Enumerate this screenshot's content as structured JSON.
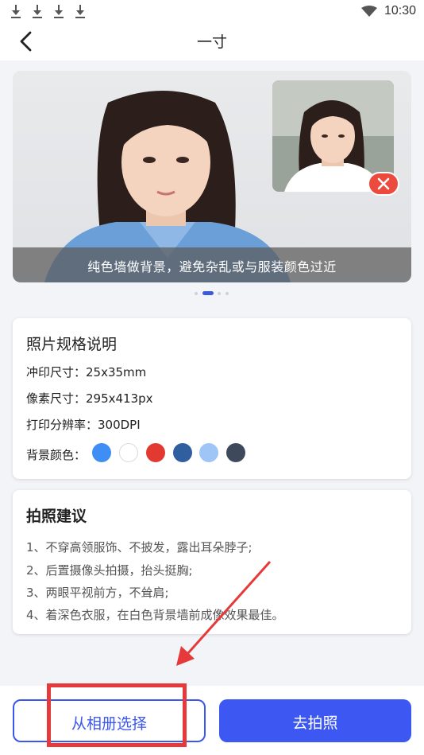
{
  "status_bar": {
    "time": "10:30",
    "download_icons": [
      "download-icon",
      "download-icon",
      "download-icon",
      "download-icon"
    ]
  },
  "nav": {
    "title": "一寸",
    "back_icon": "chevron-left-icon"
  },
  "banner": {
    "caption": "纯色墙做背景，避免杂乱或与服装颜色过近",
    "reject_icon": "close-icon",
    "slide_count": 4,
    "active_slide": 1
  },
  "spec": {
    "title": "照片规格说明",
    "print_size": "冲印尺寸：25x35mm",
    "pixel_size": "像素尺寸：295x413px",
    "resolution": "打印分辨率：300DPI",
    "bg_label": "背景颜色：",
    "bg_colors": [
      "#3f8ef5",
      "#ffffff",
      "#e23a30",
      "#2f5f9e",
      "#9fc4f6",
      "#3e4a5c"
    ]
  },
  "tips": {
    "title": "拍照建议",
    "items": [
      "1、不穿高领服饰、不披发，露出耳朵脖子;",
      "2、后置摄像头拍摄，抬头挺胸;",
      "3、两眼平视前方，不耸肩;",
      "4、着深色衣服，在白色背景墙前成像效果最佳。"
    ]
  },
  "actions": {
    "album_label": "从相册选择",
    "camera_label": "去拍照"
  },
  "colors": {
    "accent": "#3d57f3",
    "annotation": "#e63a3a",
    "reject": "#ec4a3d"
  }
}
